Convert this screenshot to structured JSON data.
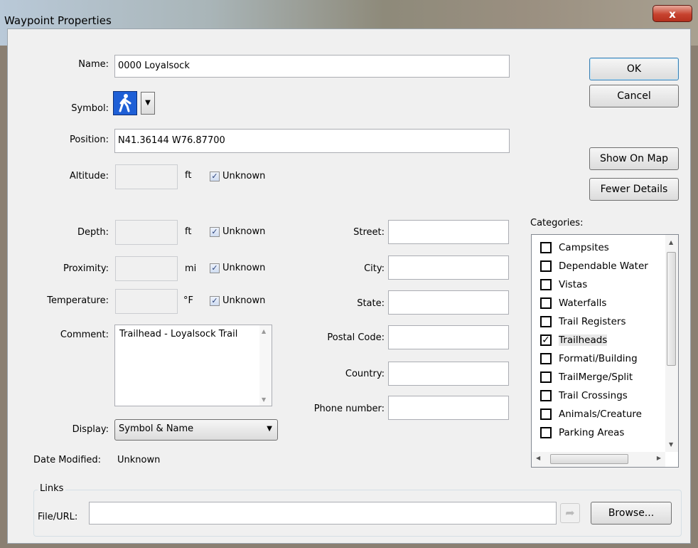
{
  "window": {
    "title": "Waypoint Properties",
    "close_glyph": "x"
  },
  "fields": {
    "name_label": "Name:",
    "name_value": "0000 Loyalsock",
    "symbol_label": "Symbol:",
    "position_label": "Position:",
    "position_value": "N41.36144 W76.87700",
    "altitude_label": "Altitude:",
    "altitude_unit": "ft",
    "depth_label": "Depth:",
    "depth_unit": "ft",
    "proximity_label": "Proximity:",
    "proximity_unit": "mi",
    "temperature_label": "Temperature:",
    "temperature_unit": "°F",
    "unknown_label": "Unknown",
    "comment_label": "Comment:",
    "comment_value": "Trailhead - Loyalsock Trail",
    "display_label": "Display:",
    "display_value": "Symbol & Name",
    "date_modified_label": "Date Modified:",
    "date_modified_value": "Unknown"
  },
  "address": {
    "street_label": "Street:",
    "city_label": "City:",
    "state_label": "State:",
    "postal_label": "Postal Code:",
    "country_label": "Country:",
    "phone_label": "Phone number:"
  },
  "buttons": {
    "ok": "OK",
    "cancel": "Cancel",
    "show_on_map": "Show On Map",
    "fewer_details": "Fewer Details",
    "browse": "Browse..."
  },
  "categories": {
    "label": "Categories:",
    "items": [
      {
        "label": "Campsites",
        "checked": false
      },
      {
        "label": "Dependable Water",
        "checked": false
      },
      {
        "label": "Vistas",
        "checked": false
      },
      {
        "label": "Waterfalls",
        "checked": false
      },
      {
        "label": "Trail Registers",
        "checked": false
      },
      {
        "label": "Trailheads",
        "checked": true
      },
      {
        "label": "Formati/Building",
        "checked": false
      },
      {
        "label": "TrailMerge/Split",
        "checked": false
      },
      {
        "label": "Trail Crossings",
        "checked": false
      },
      {
        "label": "Animals/Creature",
        "checked": false
      },
      {
        "label": "Parking Areas",
        "checked": false
      }
    ]
  },
  "links": {
    "group_label": "Links",
    "file_url_label": "File/URL:",
    "file_url_value": ""
  },
  "icons": {
    "symbol": "hiker-icon",
    "colors": {
      "symbol_bg": "#1e5fd6"
    }
  }
}
